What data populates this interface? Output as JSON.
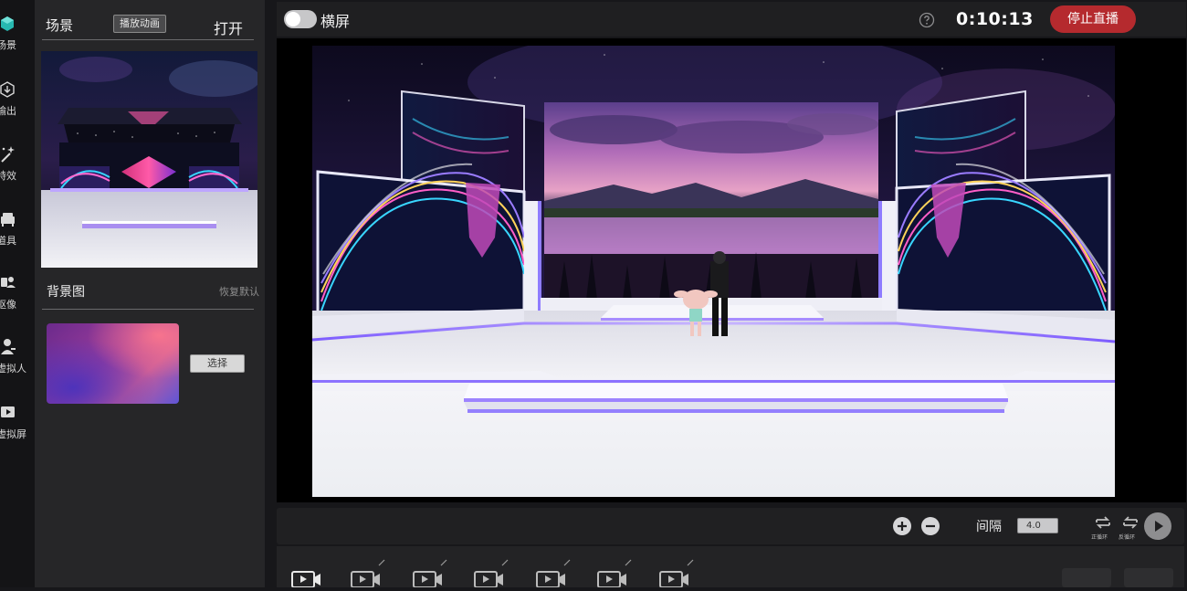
{
  "nav": {
    "items": [
      {
        "label": "场景",
        "icon": "cube-icon"
      },
      {
        "label": "输出",
        "icon": "output-icon"
      },
      {
        "label": "特效",
        "icon": "magic-wand-icon"
      },
      {
        "label": "道具",
        "icon": "props-icon"
      },
      {
        "label": "抠像",
        "icon": "keying-icon"
      },
      {
        "label": "虚拟人",
        "icon": "avatar-icon"
      },
      {
        "label": "虚拟屏",
        "icon": "screen-play-icon"
      }
    ]
  },
  "scene_panel": {
    "title": "场景",
    "play_animation": "播放动画",
    "open": "打开",
    "background_title": "背景图",
    "restore_default": "恢复默认",
    "choose": "选择"
  },
  "top_bar": {
    "orientation_label": "横屏",
    "timer": "0:10:13",
    "stop_live": "停止直播"
  },
  "controls": {
    "interval_label": "间隔",
    "interval_value": "4.0",
    "forward_loop": "正循环",
    "reverse_loop": "反循环"
  },
  "colors": {
    "accent_red": "#b52a2e",
    "cube_teal": "#27b8b0"
  }
}
